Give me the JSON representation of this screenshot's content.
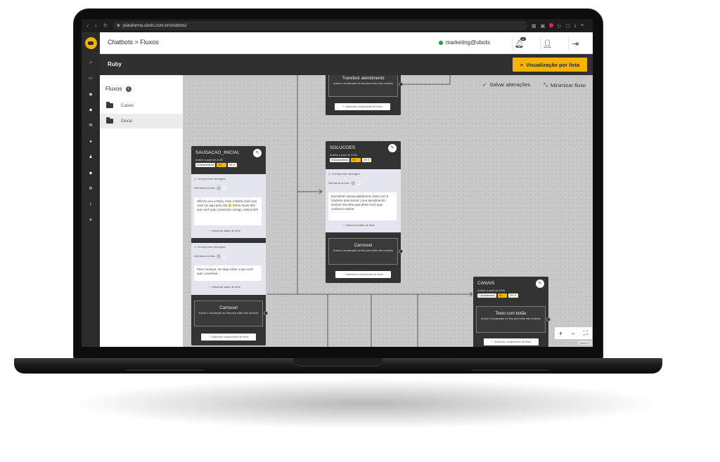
{
  "browser": {
    "url": "plataforma.ubots.com.br/chatbots/"
  },
  "header": {
    "breadcrumb": "Chatbots > Fluxos",
    "user": "marketing@ubots",
    "notif_count": "22"
  },
  "titlebar": {
    "bot_name": "Ruby",
    "view_list_label": "Visualização por lista"
  },
  "flows_panel": {
    "title": "Fluxos",
    "folders": [
      {
        "label": "Cases"
      },
      {
        "label": "Geral"
      }
    ]
  },
  "canvas": {
    "save_label": "Salvar alterações",
    "minimize_label": "Minimizar fluxo",
    "attribution": "React Fl",
    "nodes": {
      "transferir": {
        "title": "Transferir atendimento",
        "desc": "Acesse a visualização em lista para editar este conteúdo",
        "add_component": "Adicionar componente de texto"
      },
      "saudacao": {
        "title": "SAUDACAO_INICIAL",
        "since": "Análise a partir de 21/06",
        "count": "24 Acionamentos",
        "like": "0% 👍",
        "dislike": "0% 👎",
        "msg1": {
          "delay": "2s tempo entre mensagens",
          "alternatives": "Alternativas de texto",
          "text": "Olá! Eu sou a Ruby, esse rostinho lindo que você viu aqui pelo site 😊 Estou muito feliz que você quer conversar comigo, vamos lá?!",
          "add_balloon": "Adicionar balão de texto"
        },
        "msg2": {
          "delay": "2s tempo entre mensagens",
          "alternatives": "Alternativas de texto",
          "text": "Para começar, me diga sobre o que você quer conversar",
          "add_balloon": "Adicionar balão de texto"
        },
        "carousel": {
          "title": "Carrossel",
          "desc": "Acesse a visualização em lista para editar este conteúdo"
        },
        "add_component": "Adicionar componente de texto"
      },
      "solucoes": {
        "title": "SOLUCOES",
        "since": "Análise a partir de 21/06",
        "count": "26 Acionamentos",
        "like": "0% 👍",
        "dislike": "0% 👎",
        "msg1": {
          "delay": "2s tempo entre mensagens",
          "alternatives": "Alternativas de texto",
          "text": "Excelente! Nossa plataforma conta com 5 módulos para tornar o seu atendimento incrível. Escolha qual deles você quer conhecer melhor",
          "add_balloon": "Adicionar balão de texto"
        },
        "carousel": {
          "title": "Carrossel",
          "desc": "Acesse a visualização em lista para editar este conteúdo"
        },
        "add_component": "Adicionar componente de texto"
      },
      "canais": {
        "title": "CANAIS",
        "since": "Análise a partir de 21/06",
        "count": "7 Acionamentos",
        "like": "0% 👍",
        "dislike": "0% 👎",
        "button_text": {
          "title": "Texto com botão",
          "desc": "Acesse a visualização em lista para editar este conteúdo"
        },
        "add_component": "Adicionar componente de texto"
      }
    }
  },
  "colors": {
    "accent": "#f5b400",
    "sidebar": "#2b2b2b",
    "node": "#333333",
    "canvas": "#c8c8c8",
    "online": "#1e9e3e"
  }
}
